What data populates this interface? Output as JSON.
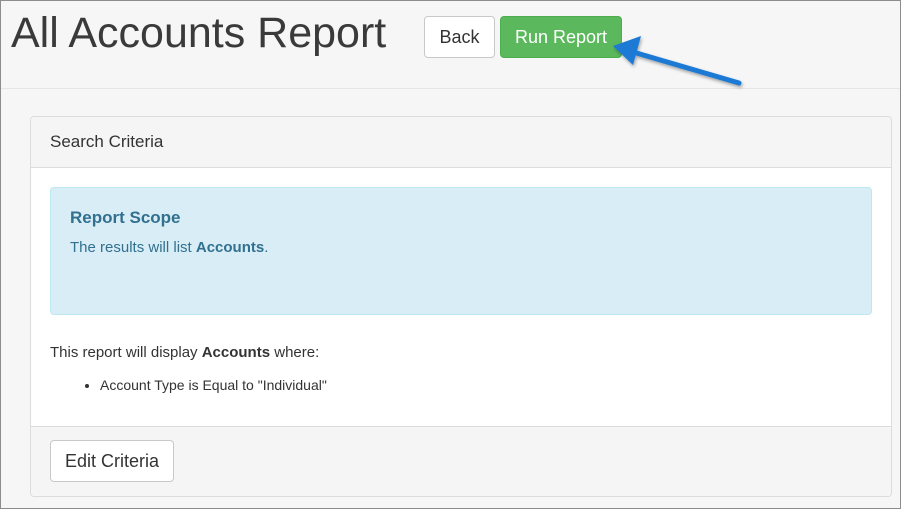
{
  "page": {
    "title": "All Accounts Report"
  },
  "toolbar": {
    "back_label": "Back",
    "run_label": "Run Report"
  },
  "panel": {
    "heading": "Search Criteria",
    "scope": {
      "title": "Report Scope",
      "text_prefix": "The results will list ",
      "text_bold": "Accounts",
      "text_suffix": "."
    },
    "description": {
      "prefix": "This report will display ",
      "bold": "Accounts",
      "suffix": " where:"
    },
    "criteria": [
      "Account Type is Equal to \"Individual\""
    ],
    "edit_label": "Edit Criteria"
  },
  "colors": {
    "run_button": "#5cb85c",
    "alert_bg": "#d9edf7",
    "alert_text": "#31708f",
    "arrow": "#1a7ad4"
  },
  "annotation": {
    "icon": "arrow-pointer-icon"
  }
}
